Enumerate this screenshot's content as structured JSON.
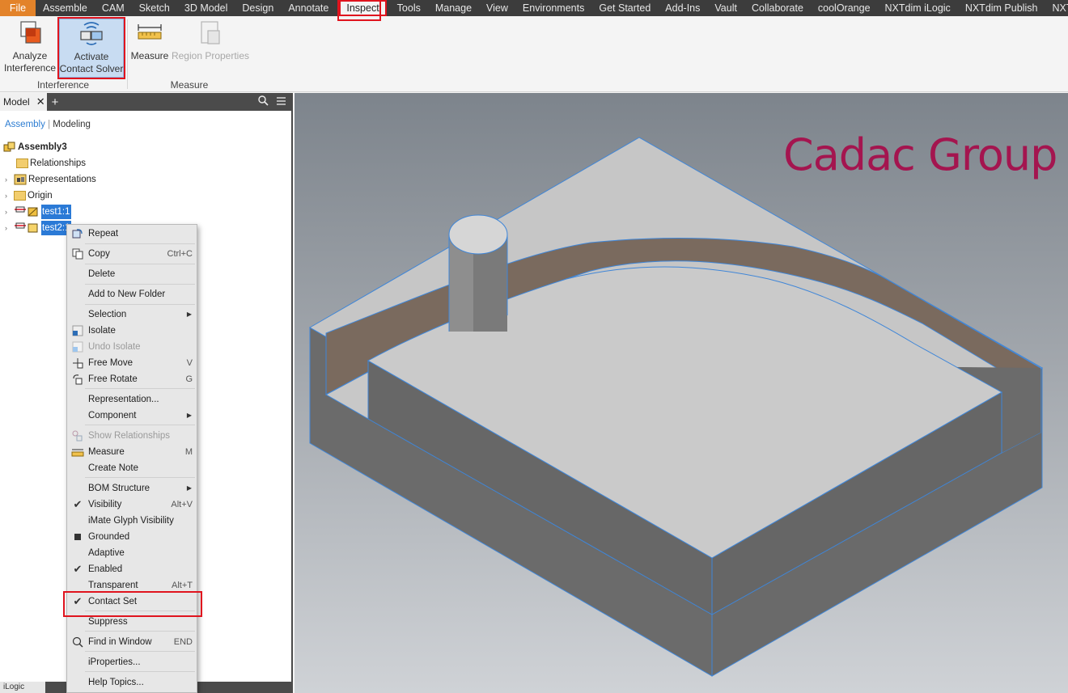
{
  "menubar": {
    "tabs": [
      "File",
      "Assemble",
      "CAM",
      "Sketch",
      "3D Model",
      "Design",
      "Annotate",
      "Inspect",
      "Tools",
      "Manage",
      "View",
      "Environments",
      "Get Started",
      "Add-Ins",
      "Vault",
      "Collaborate",
      "coolOrange",
      "NXTdim iLogic",
      "NXTdim Publish",
      "NXTdim"
    ],
    "active": "Inspect"
  },
  "ribbon": {
    "analyze_line1": "Analyze",
    "analyze_line2": "Interference",
    "activate_line1": "Activate",
    "activate_line2": "Contact Solver",
    "measure": "Measure",
    "region_properties": "Region Properties",
    "panel_interference": "Interference",
    "panel_measure": "Measure"
  },
  "browser": {
    "tab": "Model",
    "mode_assembly": "Assembly",
    "mode_modeling": "Modeling",
    "root": "Assembly3",
    "nodes": [
      "Relationships",
      "Representations",
      "Origin",
      "test1:1",
      "test2:1"
    ],
    "bottom_tab": "iLogic"
  },
  "viewport": {
    "logo_text": "Cadac Group",
    "logo_color": "#a4154f"
  },
  "context_menu": {
    "items": [
      {
        "label": "Repeat",
        "shortcut": "",
        "icon": "repeat-icon"
      },
      {
        "label": "Copy",
        "shortcut": "Ctrl+C",
        "icon": "copy-icon"
      },
      {
        "label": "Delete",
        "shortcut": ""
      },
      {
        "label": "Add to New Folder",
        "shortcut": ""
      },
      {
        "label": "Selection",
        "shortcut": "",
        "submenu": true
      },
      {
        "label": "Isolate",
        "shortcut": "",
        "icon": "isolate-icon"
      },
      {
        "label": "Undo Isolate",
        "shortcut": "",
        "icon": "undo-isolate-icon",
        "disabled": true
      },
      {
        "label": "Free Move",
        "shortcut": "V",
        "icon": "free-move-icon"
      },
      {
        "label": "Free Rotate",
        "shortcut": "G",
        "icon": "free-rotate-icon"
      },
      {
        "label": "Representation...",
        "shortcut": ""
      },
      {
        "label": "Component",
        "shortcut": "",
        "submenu": true
      },
      {
        "label": "Show Relationships",
        "shortcut": "",
        "icon": "relationships-icon",
        "disabled": true
      },
      {
        "label": "Measure",
        "shortcut": "M",
        "icon": "measure-icon"
      },
      {
        "label": "Create Note",
        "shortcut": ""
      },
      {
        "label": "BOM Structure",
        "shortcut": "",
        "submenu": true
      },
      {
        "label": "Visibility",
        "shortcut": "Alt+V",
        "checked": true
      },
      {
        "label": "iMate Glyph Visibility",
        "shortcut": ""
      },
      {
        "label": "Grounded",
        "shortcut": "",
        "icon": "grounded-icon"
      },
      {
        "label": "Adaptive",
        "shortcut": ""
      },
      {
        "label": "Enabled",
        "shortcut": "",
        "checked": true
      },
      {
        "label": "Transparent",
        "shortcut": "Alt+T"
      },
      {
        "label": "Contact Set",
        "shortcut": "",
        "checked": true
      },
      {
        "label": "Suppress",
        "shortcut": ""
      },
      {
        "label": "Find in Window",
        "shortcut": "END",
        "icon": "find-icon"
      },
      {
        "label": "iProperties...",
        "shortcut": ""
      },
      {
        "label": "Help Topics...",
        "shortcut": ""
      }
    ]
  },
  "colors": {
    "highlight": "#e0141e",
    "file_tab": "#e3832a",
    "selection": "#2b7ad6"
  }
}
